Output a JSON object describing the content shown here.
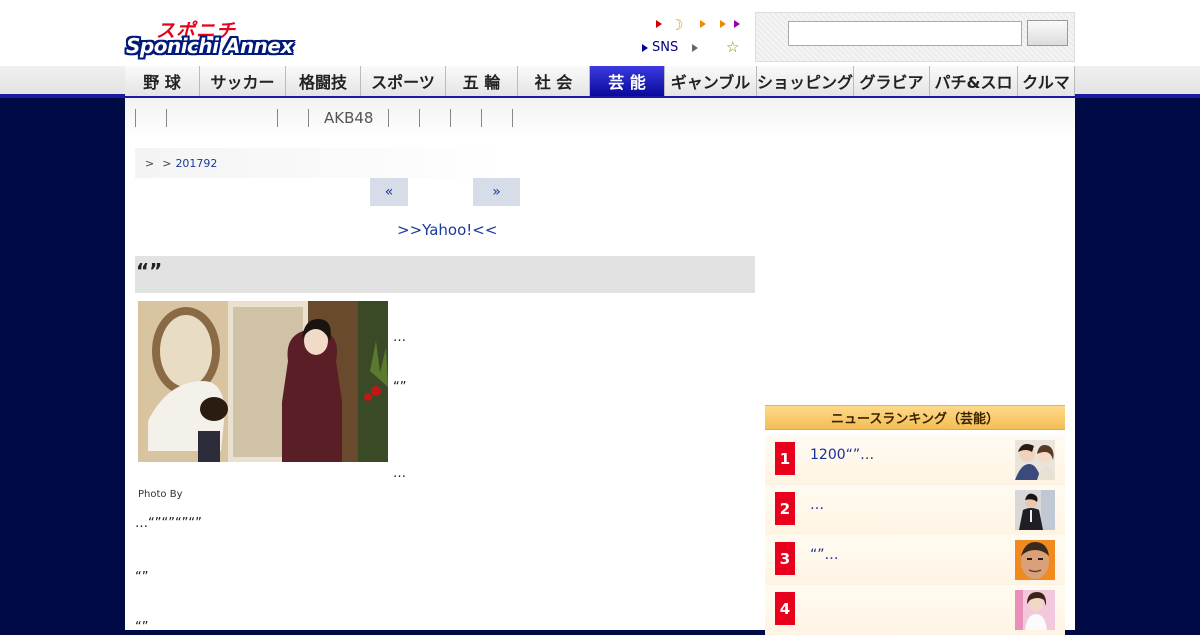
{
  "header": {
    "logo_jp": "スポニチ",
    "logo_en": "Sponichi Annex",
    "sns_label": "SNS",
    "search": {
      "value": "",
      "button_label": ""
    }
  },
  "global_nav": [
    {
      "label": "野 球",
      "active": false
    },
    {
      "label": "サッカー",
      "active": false
    },
    {
      "label": "格闘技",
      "active": false
    },
    {
      "label": "スポーツ",
      "active": false
    },
    {
      "label": "五 輪",
      "active": false
    },
    {
      "label": "社 会",
      "active": false
    },
    {
      "label": "芸 能",
      "active": true
    },
    {
      "label": "ギャンブル",
      "active": false
    },
    {
      "label": "ショッピング",
      "active": false
    },
    {
      "label": "グラビア",
      "active": false
    },
    {
      "label": "パチ&スロ",
      "active": false
    },
    {
      "label": "クルマ",
      "active": false
    }
  ],
  "sub_nav": [
    "",
    "",
    "",
    "AKB48",
    "",
    "",
    "",
    "",
    ""
  ],
  "breadcrumb": {
    "sep1": ">",
    "sep2": ">",
    "date_link": "201792"
  },
  "pager": {
    "prev": "«",
    "next": "»"
  },
  "yahoo_link": ">>Yahoo!<<",
  "article": {
    "headline": "“”",
    "photo_credit": "Photo By",
    "p1": "…",
    "p2": "“”",
    "p3": "…",
    "p4": "…“”“”“”“”",
    "p5": "“”",
    "p6": "“”"
  },
  "ranking": {
    "title": "ニュースランキング（芸能）",
    "items": [
      {
        "rank": "1",
        "title": "1200“”…"
      },
      {
        "rank": "2",
        "title": "…"
      },
      {
        "rank": "3",
        "title": "“”…"
      },
      {
        "rank": "4",
        "title": ""
      }
    ]
  },
  "colors": {
    "page_bg": "#000a44",
    "nav_active": "#0a0a9a",
    "rank_red": "#e8001c",
    "ranking_header": "#f3be54",
    "link_blue": "#1a3a9a"
  }
}
